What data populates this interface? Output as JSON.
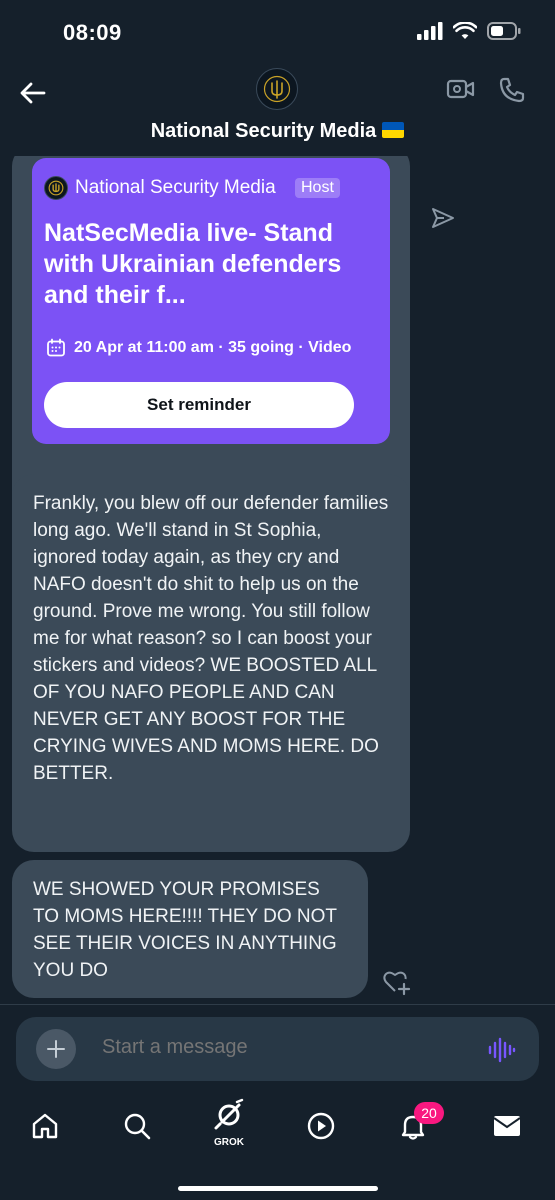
{
  "status_bar": {
    "time": "08:09"
  },
  "header": {
    "title": "National Security Media"
  },
  "event": {
    "host_name": "National Security Media",
    "host_badge": "Host",
    "title": "NatSecMedia live- Stand with Ukrainian defenders and their f...",
    "meta": "20 Apr at 11:00 am · 35 going · Video",
    "reminder_label": "Set reminder"
  },
  "messages": [
    {
      "text": "Frankly, you blew off our defender families long ago. We'll stand in St Sophia, ignored today again, as they cry and NAFO doesn't do shit to help us on the ground. Prove me wrong. You still follow me for what reason? so I can boost your stickers and videos? WE BOOSTED ALL OF YOU NAFO PEOPLE AND CAN NEVER GET ANY BOOST FOR THE CRYING WIVES AND MOMS HERE. DO BETTER."
    },
    {
      "text": "WE SHOWED YOUR PROMISES TO MOMS HERE!!!! THEY DO NOT SEE THEIR VOICES IN ANYTHING YOU DO"
    }
  ],
  "composer": {
    "placeholder": "Start a message"
  },
  "tabbar": {
    "grok_label": "GROK",
    "notification_count": "20"
  },
  "colors": {
    "background": "#15202b",
    "bubble": "#3b4a58",
    "event_card": "#7c52f5",
    "badge": "#f91880",
    "voice": "#7856ff"
  }
}
